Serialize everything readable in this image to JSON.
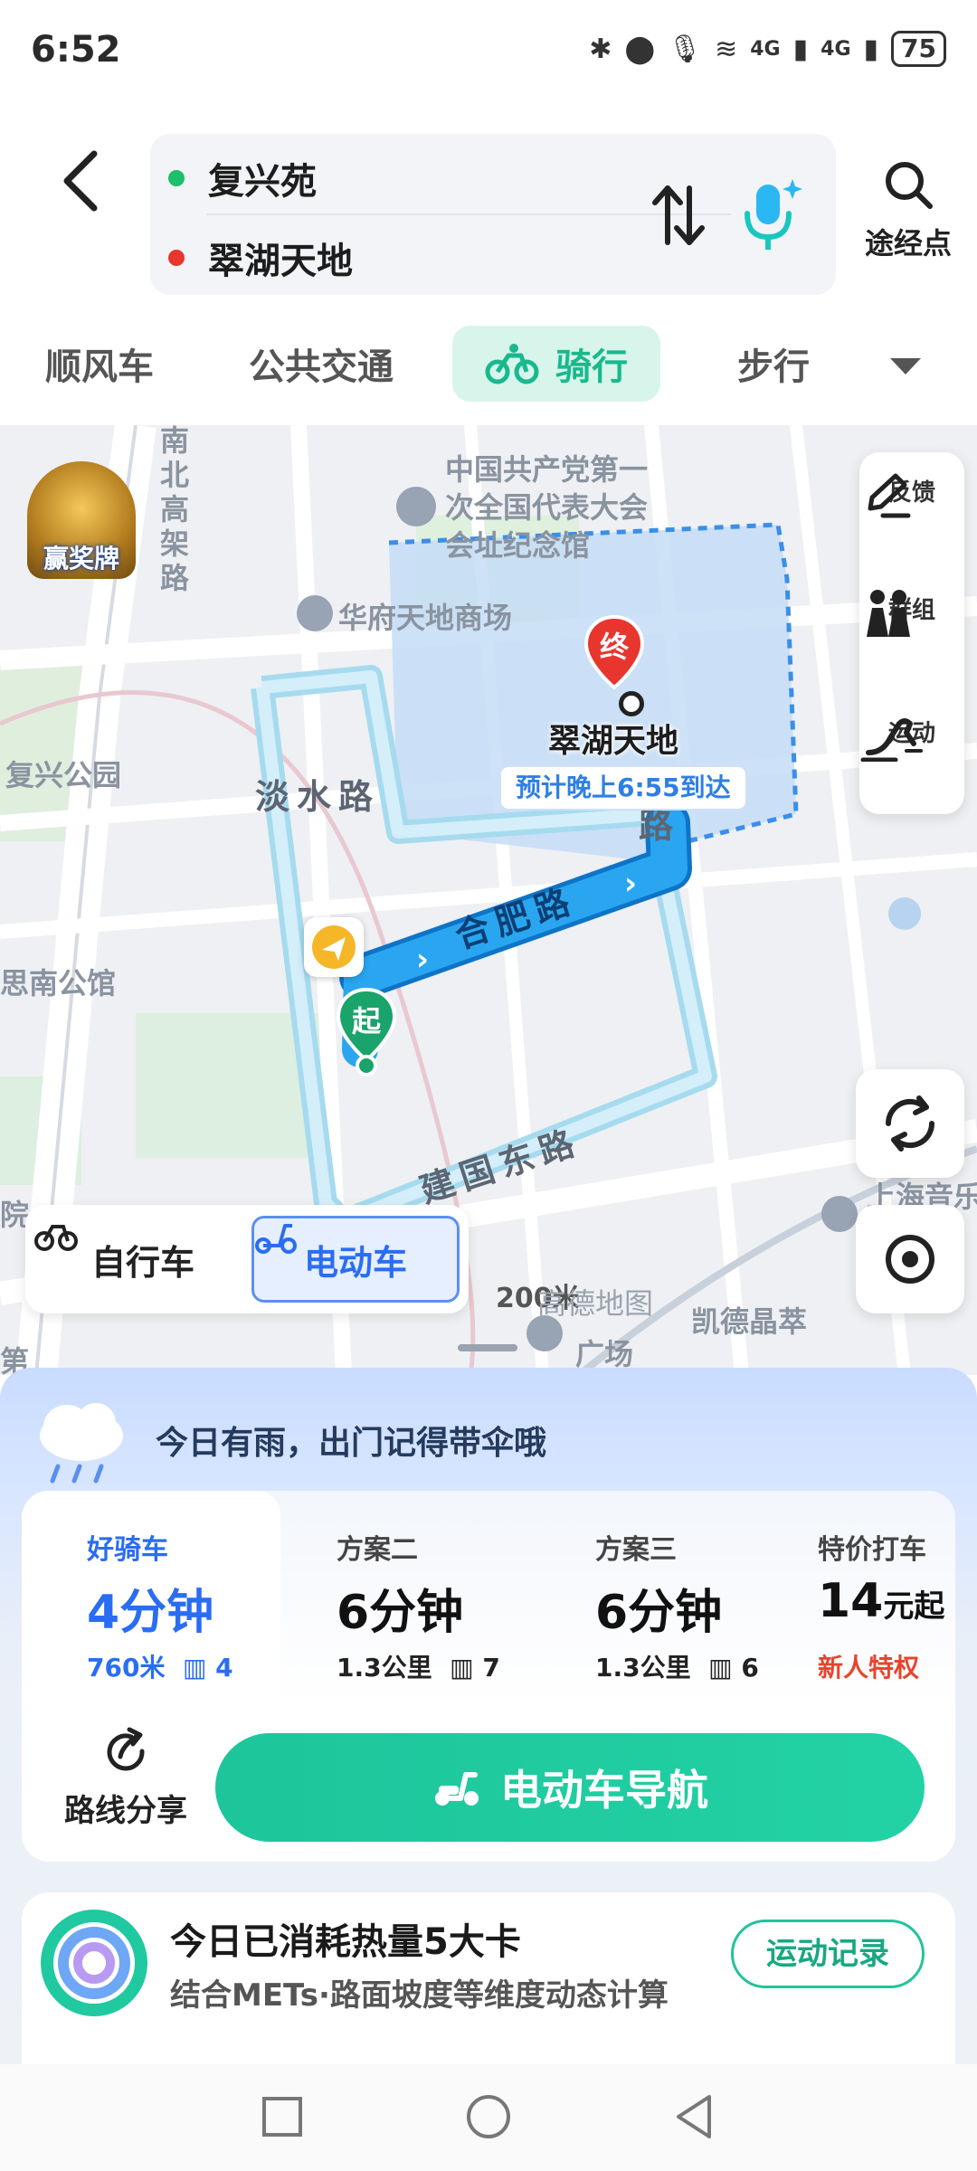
{
  "status_bar": {
    "time": "6:52",
    "network_1": "4G",
    "network_2": "4G",
    "battery": "75"
  },
  "header": {
    "start": "复兴苑",
    "end": "翠湖天地",
    "waypoint_label": "途经点",
    "start_dot_color": "#1cbf6a",
    "end_dot_color": "#e8352e"
  },
  "tabs": [
    {
      "label": "顺风车"
    },
    {
      "label": "公共交通"
    },
    {
      "label": "骑行"
    },
    {
      "label": "步行"
    }
  ],
  "map": {
    "labels": {
      "road_nanbei": "南北高架路",
      "cpc_memorial": "中国共产党第一次全国代表大会会址纪念馆",
      "cpc_1": "中国共产党第一",
      "cpc_2": "次全国代表大会",
      "cpc_3": "会址纪念馆",
      "huafu": "华府天地商场",
      "fuxing_park": "复兴公园",
      "sinan": "思南公馆",
      "danshui": "淡水路",
      "hefei": "合肥路",
      "jianguo_east": "建国东路",
      "dest_road": "路",
      "shanghai_music": "上海音乐",
      "kaide": "凯德晶萃",
      "kaide_2": "广场",
      "partial_yuan": "院",
      "partial_di": "第"
    },
    "destination_name": "翠湖天地",
    "end_marker": "终",
    "start_marker": "起",
    "eta": "预计晚上6:55到达",
    "scale": "200米",
    "watermark": "高德地图",
    "promo_badge": "赢奖牌",
    "side_panel": [
      {
        "label": "反馈",
        "icon": "edit-icon"
      },
      {
        "label": "群组",
        "icon": "group-icon"
      },
      {
        "label": "运动",
        "icon": "run-icon"
      }
    ],
    "mode_switch": {
      "bike": "自行车",
      "ebike": "电动车",
      "selected": "ebike"
    },
    "route_color": "#2aa6f0",
    "area_color": "#c4dcf6"
  },
  "sheet": {
    "weather": "今日有雨，出门记得带伞哦",
    "plans": [
      {
        "title": "好骑车",
        "time": "4分钟",
        "distance": "760米",
        "lights": "4",
        "selected": true
      },
      {
        "title": "方案二",
        "time": "6分钟",
        "distance": "1.3公里",
        "lights": "7"
      },
      {
        "title": "方案三",
        "time": "6分钟",
        "distance": "1.3公里",
        "lights": "6"
      },
      {
        "title": "特价打车",
        "price": "14",
        "price_unit": "元起",
        "promo": "新人特权"
      }
    ],
    "share_label": "路线分享",
    "nav_label": "电动车导航",
    "calorie_title": "今日已消耗热量5大卡",
    "calorie_sub": "结合METs·路面坡度等维度动态计算",
    "record_label": "运动记录"
  }
}
